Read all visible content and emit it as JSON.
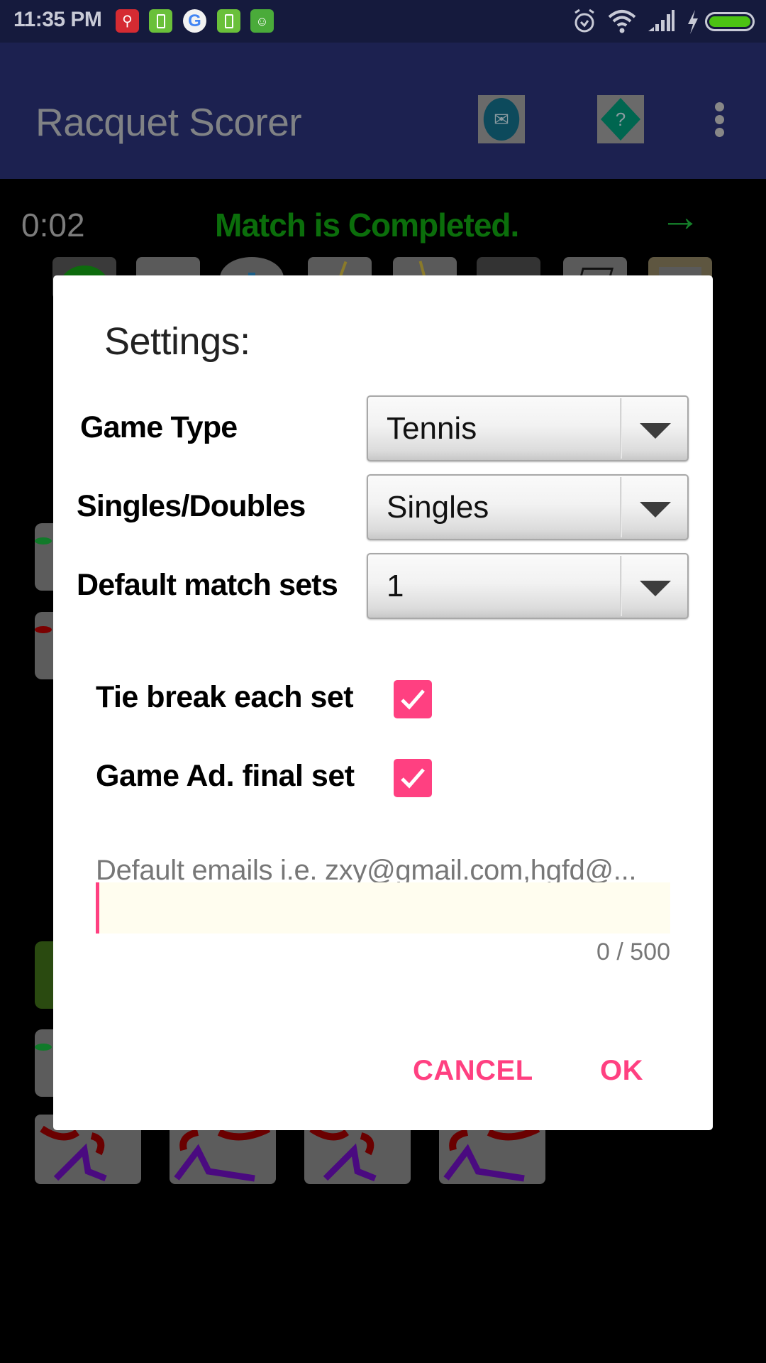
{
  "status_bar": {
    "time": "11:35 PM",
    "notification_icons": [
      "app-red-icon",
      "battery-app-icon",
      "google-icon",
      "battery-app-icon",
      "android-icon"
    ],
    "system_icons": [
      "alarm-icon",
      "wifi-icon",
      "signal-icon",
      "charging-icon",
      "battery-icon"
    ],
    "battery_level_fraction": 1.0,
    "battery_color": "#4cc313"
  },
  "app_bar": {
    "title": "Racquet Scorer",
    "actions": [
      "email-icon",
      "help-icon",
      "overflow-menu-icon"
    ],
    "help_glyph": "?"
  },
  "match": {
    "timer": "0:02",
    "status": "Match is Completed.",
    "status_color": "#0b6e0b",
    "next_arrow": "→"
  },
  "dialog": {
    "title": "Settings:",
    "fields": [
      {
        "label": "Game Type",
        "value": "Tennis"
      },
      {
        "label": "Singles/Doubles",
        "value": "Singles"
      },
      {
        "label": "Default match sets",
        "value": "1"
      }
    ],
    "checkboxes": [
      {
        "label": "Tie break each set",
        "checked": true
      },
      {
        "label": "Game Ad. final set",
        "checked": true
      }
    ],
    "email": {
      "placeholder": "Default emails i.e. zxy@gmail.com,hgfd@...",
      "value": "",
      "counter": "0 / 500"
    },
    "buttons": {
      "cancel": "CANCEL",
      "ok": "OK"
    },
    "accent_color": "#ff4081"
  }
}
